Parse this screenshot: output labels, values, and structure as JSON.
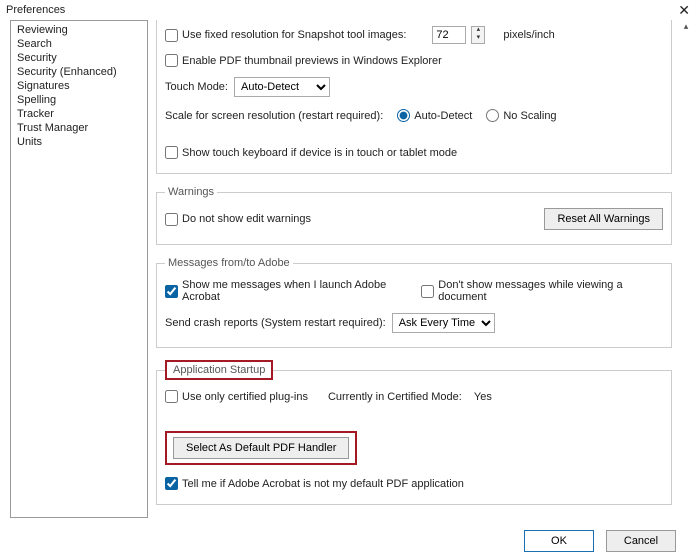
{
  "window": {
    "title": "Preferences"
  },
  "sidebar": {
    "items": [
      "Reviewing",
      "Search",
      "Security",
      "Security (Enhanced)",
      "Signatures",
      "Spelling",
      "Tracker",
      "Trust Manager",
      "Units"
    ]
  },
  "basic": {
    "fixed_res_label": "Use fixed resolution for Snapshot tool images:",
    "fixed_res_value": "72",
    "fixed_res_unit": "pixels/inch",
    "thumb_label": "Enable PDF thumbnail previews in Windows Explorer",
    "touch_mode_label": "Touch Mode:",
    "touch_mode_value": "Auto-Detect",
    "scale_label": "Scale for screen resolution (restart required):",
    "scale_auto": "Auto-Detect",
    "scale_none": "No Scaling",
    "touch_kb_label": "Show touch keyboard if device is in touch or tablet mode"
  },
  "warnings": {
    "legend": "Warnings",
    "dont_show_label": "Do not show edit warnings",
    "reset_btn": "Reset All Warnings"
  },
  "messages": {
    "legend": "Messages from/to Adobe",
    "show_launch_label": "Show me messages when I launch Adobe Acrobat",
    "dont_show_view_label": "Don't show messages while viewing a document",
    "crash_label": "Send crash reports (System restart required):",
    "crash_value": "Ask Every Time"
  },
  "startup": {
    "legend": "Application Startup",
    "cert_plugins_label": "Use only certified plug-ins",
    "cert_mode_label": "Currently in Certified Mode:",
    "cert_mode_value": "Yes",
    "default_handler_btn": "Select As Default PDF Handler",
    "tell_me_label": "Tell me if Adobe Acrobat is not my default PDF application"
  },
  "footer": {
    "ok": "OK",
    "cancel": "Cancel"
  }
}
